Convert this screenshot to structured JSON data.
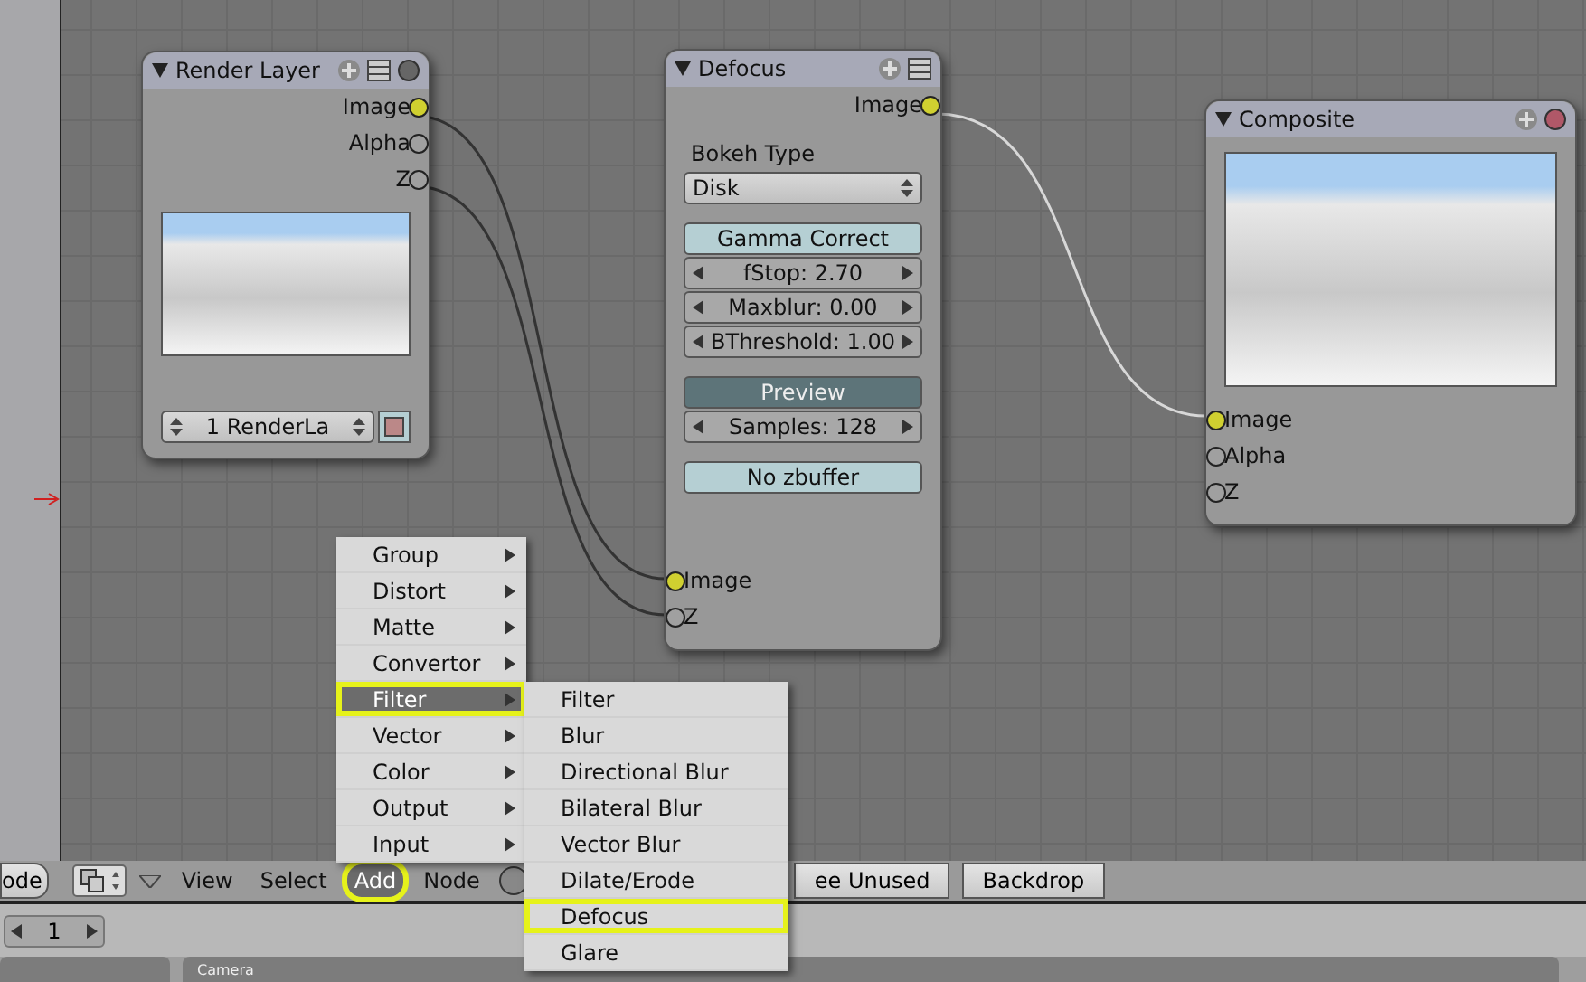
{
  "nodes": [
    {
      "kind": "render_layer",
      "title": "Render Layer",
      "outputs": [
        {
          "label": "Image",
          "kind": "color"
        },
        {
          "label": "Alpha",
          "kind": "value"
        },
        {
          "label": "Z",
          "kind": "value"
        }
      ],
      "layer": "1 RenderLa"
    },
    {
      "kind": "defocus",
      "title": "Defocus",
      "outputs": [
        {
          "label": "Image",
          "kind": "color"
        }
      ],
      "groups": [
        [
          {
            "kind": "label",
            "text": "Bokeh Type"
          },
          {
            "kind": "dropdown",
            "value": "Disk"
          }
        ],
        [
          {
            "kind": "toggle",
            "label": "Gamma Correct",
            "on": false
          },
          {
            "kind": "number",
            "label": "fStop: 2.70"
          },
          {
            "kind": "number",
            "label": "Maxblur: 0.00"
          },
          {
            "kind": "number",
            "label": "BThreshold: 1.00"
          }
        ],
        [
          {
            "kind": "toggle",
            "label": "Preview",
            "on": true
          },
          {
            "kind": "number",
            "label": "Samples: 128"
          }
        ],
        [
          {
            "kind": "toggle",
            "label": "No zbuffer",
            "on": false
          }
        ]
      ],
      "inputs": [
        {
          "label": "Image",
          "kind": "color"
        },
        {
          "label": "Z",
          "kind": "value"
        }
      ]
    },
    {
      "kind": "composite",
      "title": "Composite",
      "inputs": [
        {
          "label": "Image",
          "kind": "color"
        },
        {
          "label": "Alpha",
          "kind": "value"
        },
        {
          "label": "Z",
          "kind": "value"
        }
      ]
    }
  ],
  "add_menu": {
    "items": [
      {
        "label": "Group",
        "selected": false,
        "highlighted": false
      },
      {
        "label": "Distort",
        "selected": false,
        "highlighted": false
      },
      {
        "label": "Matte",
        "selected": false,
        "highlighted": false
      },
      {
        "label": "Convertor",
        "selected": false,
        "highlighted": false
      },
      {
        "label": "Filter",
        "selected": true,
        "highlighted": true
      },
      {
        "label": "Vector",
        "selected": false,
        "highlighted": false
      },
      {
        "label": "Color",
        "selected": false,
        "highlighted": false
      },
      {
        "label": "Output",
        "selected": false,
        "highlighted": false
      },
      {
        "label": "Input",
        "selected": false,
        "highlighted": false
      }
    ]
  },
  "filter_submenu": {
    "items": [
      {
        "label": "Filter",
        "selected": false,
        "highlighted": false
      },
      {
        "label": "Blur",
        "selected": false,
        "highlighted": false
      },
      {
        "label": "Directional Blur",
        "selected": false,
        "highlighted": false
      },
      {
        "label": "Bilateral Blur",
        "selected": false,
        "highlighted": false
      },
      {
        "label": "Vector Blur",
        "selected": false,
        "highlighted": false
      },
      {
        "label": "Dilate/Erode",
        "selected": false,
        "highlighted": false
      },
      {
        "label": "Defocus",
        "selected": false,
        "highlighted": true
      },
      {
        "label": "Glare",
        "selected": false,
        "highlighted": false
      }
    ]
  },
  "header": {
    "items": [
      {
        "kind": "button",
        "label": "ode"
      },
      {
        "kind": "icon_select"
      },
      {
        "kind": "collapse"
      },
      {
        "kind": "menu",
        "label": "View",
        "selected": false,
        "highlighted": false
      },
      {
        "kind": "menu",
        "label": "Select",
        "selected": false,
        "highlighted": false
      },
      {
        "kind": "menu",
        "label": "Add",
        "selected": true,
        "highlighted": true
      },
      {
        "kind": "menu",
        "label": "Node",
        "selected": false,
        "highlighted": false
      },
      {
        "kind": "sphere"
      },
      {
        "kind": "button",
        "label": "ee Unused"
      },
      {
        "kind": "button",
        "label": "Backdrop"
      }
    ]
  },
  "frame_field": {
    "value": "1"
  },
  "panels": [
    {
      "title": "Camera"
    }
  ]
}
